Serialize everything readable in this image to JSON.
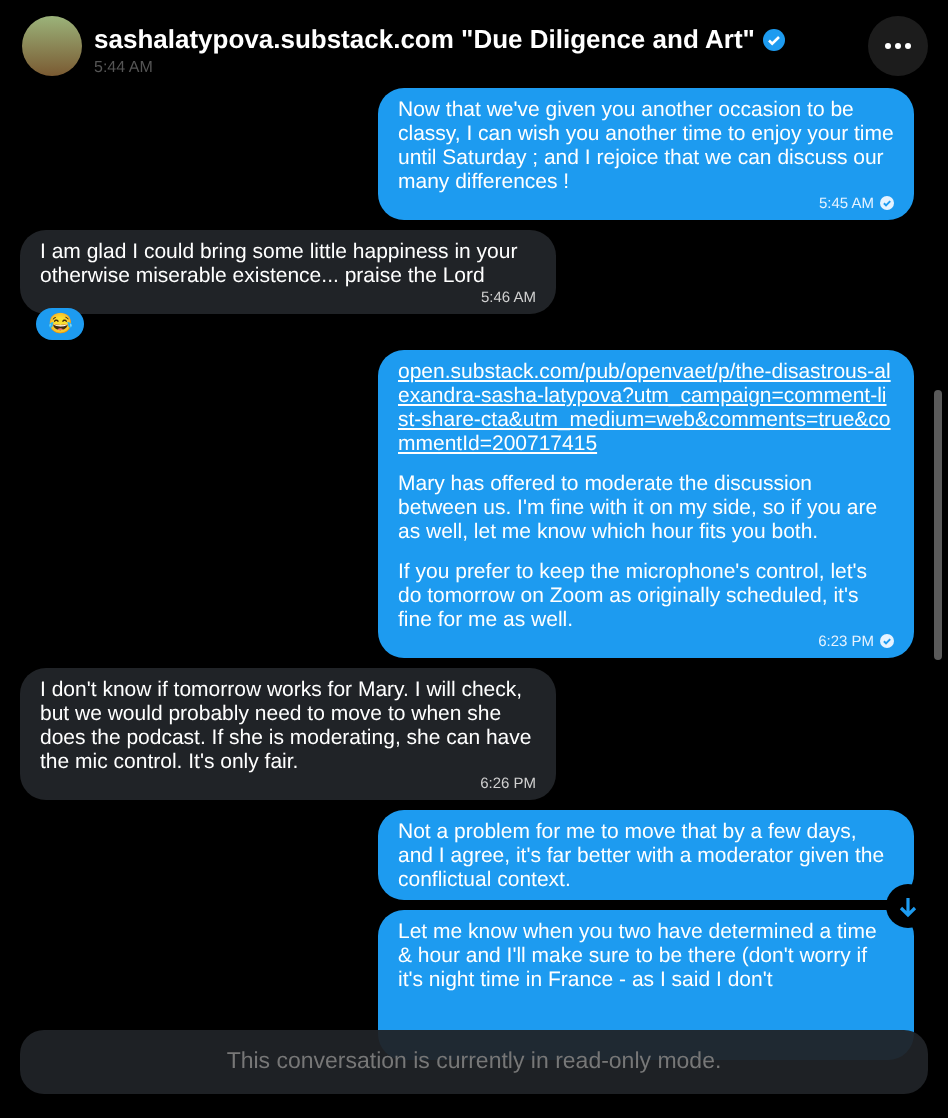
{
  "header": {
    "name": "sashalatypova.substack.com \"Due Diligence and Art\"",
    "verified": true,
    "time": "5:44 AM"
  },
  "messages": [
    {
      "kind": "sent",
      "paragraphs": [
        "Now that we've given you another occasion to be classy, I can wish you another time to enjoy your time until Saturday ; and I rejoice that we can discuss our many differences !"
      ],
      "time": "5:45 AM",
      "read": true
    },
    {
      "kind": "received",
      "paragraphs": [
        "I am glad I could bring some little happiness in your otherwise miserable existence... praise the Lord"
      ],
      "time": "5:46 AM",
      "reaction": "😂"
    },
    {
      "kind": "sent",
      "link": "open.substack.com/pub/openvaet/p/the-disastrous-alexandra-sasha-latypova?utm_campaign=comment-list-share-cta&utm_medium=web&comments=true&commentId=200717415",
      "paragraphs": [
        "Mary has offered to moderate the discussion between us. I'm fine with it on my side, so if you are as well, let me know which hour fits you both.",
        "If you prefer to keep the microphone's control, let's do tomorrow on Zoom as originally scheduled, it's fine for me as well."
      ],
      "time": "6:23 PM",
      "read": true
    },
    {
      "kind": "received",
      "paragraphs": [
        "I don't know if tomorrow works for Mary.  I will check, but we would probably need to move to when she does the podcast. If she is moderating, she can have the mic control.  It's only fair."
      ],
      "time": "6:26 PM"
    },
    {
      "kind": "sent",
      "paragraphs": [
        "Not a problem for me to move that by a few days, and I agree, it's far better with a moderator given the conflictual context."
      ]
    },
    {
      "kind": "sent",
      "paragraphs": [
        "Let me know when you two have determined a time & hour and I'll make sure to be there (don't worry if it's night time in France - as I said I don't"
      ]
    }
  ],
  "notice": "This conversation is currently in read-only mode."
}
